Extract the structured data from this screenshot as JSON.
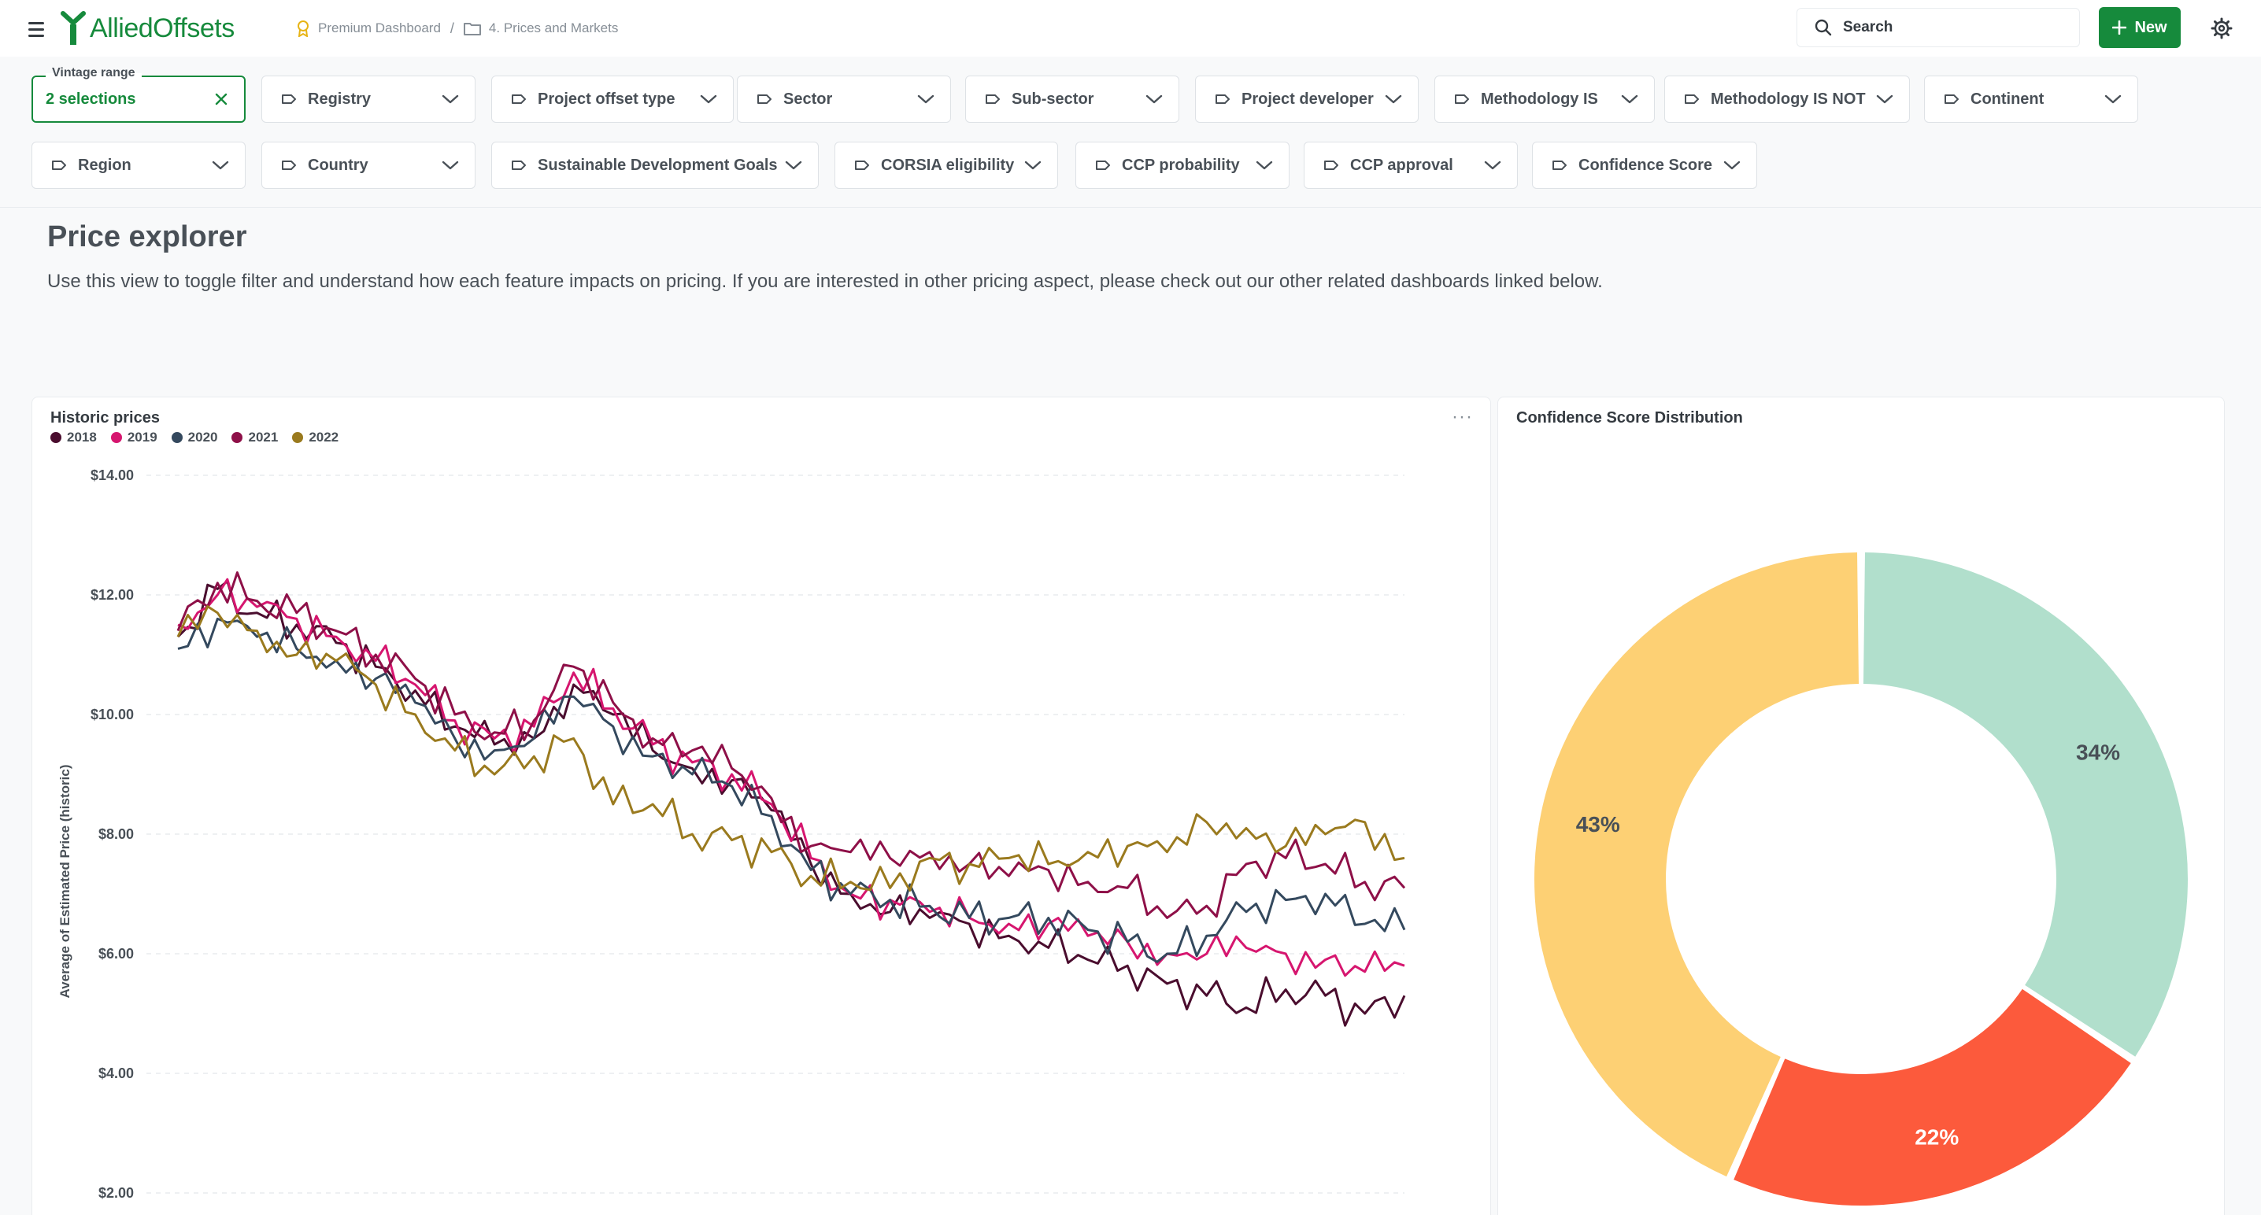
{
  "header": {
    "logo_text": "AlliedOffsets",
    "breadcrumb": [
      "Premium Dashboard",
      "4. Prices and Markets"
    ],
    "search_placeholder": "Search",
    "new_label": "New",
    "brand_color": "#168a3c"
  },
  "filters": {
    "vintage": {
      "legend": "Vintage range",
      "value": "2 selections"
    },
    "items": [
      "Registry",
      "Project offset type",
      "Sector",
      "Sub-sector",
      "Project developer",
      "Methodology IS",
      "Methodology IS NOT",
      "Continent",
      "Region",
      "Country",
      "Sustainable Development Goals",
      "CORSIA eligibility",
      "CCP probability",
      "CCP approval",
      "Confidence Score"
    ]
  },
  "page": {
    "title": "Price explorer",
    "description": "Use this view to toggle filter and understand how each feature impacts on pricing. If you are interested in other pricing aspect, please check out our other related dashboards linked below."
  },
  "historic_card": {
    "title": "Historic prices",
    "menu": "···"
  },
  "donut_card": {
    "title": "Confidence Score Distribution"
  },
  "chart_data": [
    {
      "type": "line",
      "title": "Historic prices",
      "ylabel": "Average of Estimated Price (historic)",
      "yticks": [
        "$14.00",
        "$12.00",
        "$10.00",
        "$8.00",
        "$6.00",
        "$4.00",
        "$2.00"
      ],
      "ylim": [
        2,
        14
      ],
      "grid": true,
      "legend": "top-left",
      "x": [
        0,
        4,
        8,
        12,
        16,
        20,
        24,
        28,
        32,
        36,
        40,
        44,
        48,
        52,
        56,
        60,
        64,
        68,
        72,
        76,
        80,
        84,
        88,
        92,
        96,
        100,
        104,
        108,
        112,
        116,
        120,
        124
      ],
      "series": [
        {
          "name": "2018",
          "color": "#4a0d2e",
          "values": [
            11.3,
            12.1,
            11.7,
            11.5,
            11.2,
            10.8,
            10.4,
            9.8,
            9.5,
            9.6,
            10.5,
            10.0,
            9.4,
            9.1,
            8.9,
            8.4,
            7.5,
            7.0,
            6.7,
            6.6,
            6.5,
            6.3,
            6.1,
            5.9,
            5.8,
            5.5,
            5.3,
            5.1,
            5.4,
            5.3,
            5.0,
            5.3
          ]
        },
        {
          "name": "2019",
          "color": "#d6166f",
          "values": [
            11.5,
            12.0,
            11.8,
            11.6,
            11.3,
            10.9,
            10.5,
            9.9,
            9.6,
            9.8,
            10.7,
            10.1,
            9.5,
            9.2,
            9.0,
            8.5,
            7.6,
            7.0,
            6.9,
            6.7,
            6.6,
            6.5,
            6.5,
            6.3,
            6.2,
            6.0,
            6.0,
            6.1,
            6.0,
            5.9,
            5.7,
            5.8
          ]
        },
        {
          "name": "2020",
          "color": "#34495e",
          "values": [
            11.1,
            11.6,
            11.3,
            11.1,
            10.9,
            10.6,
            10.2,
            9.6,
            9.4,
            9.6,
            10.3,
            9.8,
            9.3,
            9.0,
            8.8,
            8.3,
            7.4,
            7.0,
            6.9,
            6.8,
            6.6,
            6.6,
            6.6,
            6.4,
            6.2,
            6.0,
            6.3,
            6.7,
            6.9,
            7.0,
            6.5,
            6.4
          ]
        },
        {
          "name": "2021",
          "color": "#8e1048",
          "values": [
            11.4,
            12.2,
            11.9,
            11.7,
            11.4,
            11.0,
            10.6,
            10.0,
            9.7,
            9.9,
            10.8,
            10.2,
            9.6,
            9.4,
            9.1,
            8.6,
            7.8,
            7.7,
            7.6,
            7.7,
            7.5,
            7.3,
            7.4,
            7.2,
            7.1,
            6.6,
            6.8,
            7.5,
            7.6,
            7.5,
            7.2,
            7.1
          ]
        },
        {
          "name": "2022",
          "color": "#9a7a1e",
          "values": [
            11.3,
            11.7,
            11.4,
            11.0,
            10.9,
            10.5,
            10.0,
            9.4,
            9.0,
            9.3,
            9.6,
            8.5,
            8.5,
            8.0,
            7.9,
            7.7,
            7.3,
            7.2,
            7.1,
            7.6,
            7.5,
            7.6,
            7.5,
            7.7,
            7.8,
            7.7,
            8.2,
            8.1,
            7.8,
            8.0,
            8.2,
            7.6
          ]
        }
      ]
    },
    {
      "type": "pie",
      "title": "Confidence Score Distribution",
      "slices": [
        {
          "label": "34%",
          "value": 34,
          "color": "#b1dfcc"
        },
        {
          "label": "22%",
          "value": 22,
          "color": "#fc5a3c"
        },
        {
          "label": "43%",
          "value": 43,
          "color": "#fdd074"
        }
      ]
    }
  ]
}
